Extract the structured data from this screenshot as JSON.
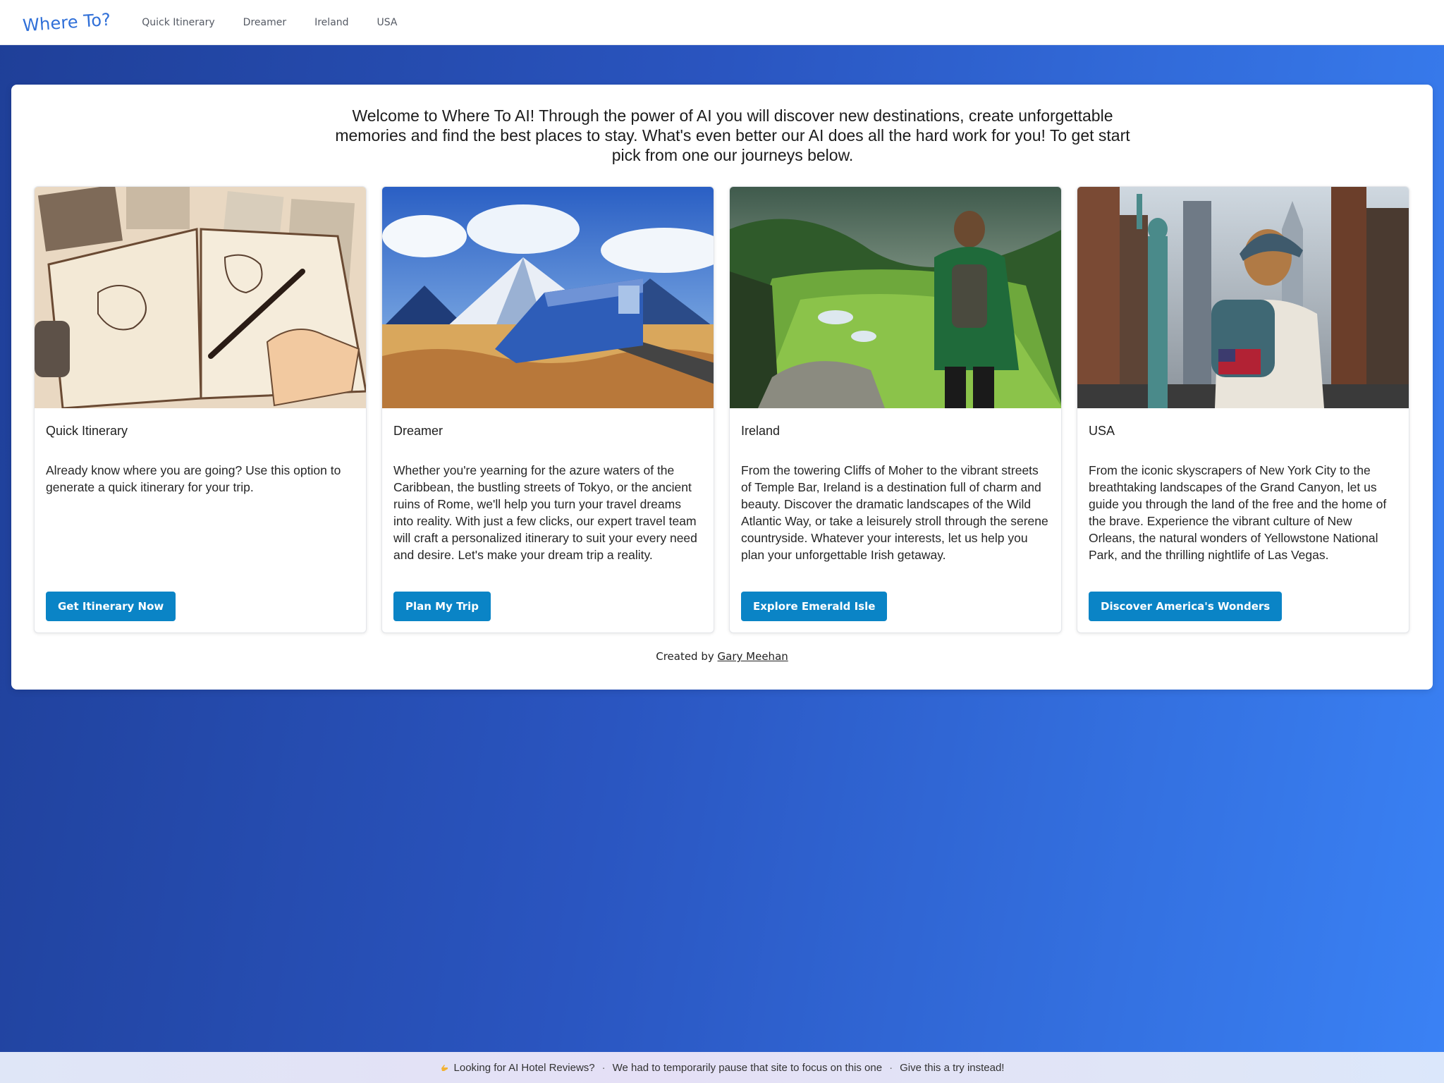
{
  "nav": {
    "brand": "Where To?",
    "links": [
      "Quick Itinerary",
      "Dreamer",
      "Ireland",
      "USA"
    ]
  },
  "intro": "Welcome to Where To AI! Through the power of AI you will discover new destinations, create unforgettable memories and find the best places to stay. What's even better our AI does all the hard work for you! To get start pick from one our journeys below.",
  "cards": [
    {
      "title": "Quick Itinerary",
      "text": "Already know where you are going? Use this option to generate a quick itinerary for your trip.",
      "button": "Get Itinerary Now"
    },
    {
      "title": "Dreamer",
      "text": "Whether you're yearning for the azure waters of the Caribbean, the bustling streets of Tokyo, or the ancient ruins of Rome, we'll help you turn your travel dreams into reality. With just a few clicks, our expert travel team will craft a personalized itinerary to suit your every need and desire. Let's make your dream trip a reality.",
      "button": "Plan My Trip"
    },
    {
      "title": "Ireland",
      "text": "From the towering Cliffs of Moher to the vibrant streets of Temple Bar, Ireland is a destination full of charm and beauty. Discover the dramatic landscapes of the Wild Atlantic Way, or take a leisurely stroll through the serene countryside. Whatever your interests, let us help you plan your unforgettable Irish getaway.",
      "button": "Explore Emerald Isle"
    },
    {
      "title": "USA",
      "text": "From the iconic skyscrapers of New York City to the breathtaking landscapes of the Grand Canyon, let us guide you through the land of the free and the home of the brave. Experience the vibrant culture of New Orleans, the natural wonders of Yellowstone National Park, and the thrilling nightlife of Las Vegas.",
      "button": "Discover America's Wonders"
    }
  ],
  "credit": {
    "prefix": "Created by",
    "author": "Gary Meehan"
  },
  "banner": {
    "part1": "Looking for AI Hotel Reviews?",
    "part2": "We had to temporarily pause that site to focus on this one",
    "part3": "Give this a try instead!"
  }
}
